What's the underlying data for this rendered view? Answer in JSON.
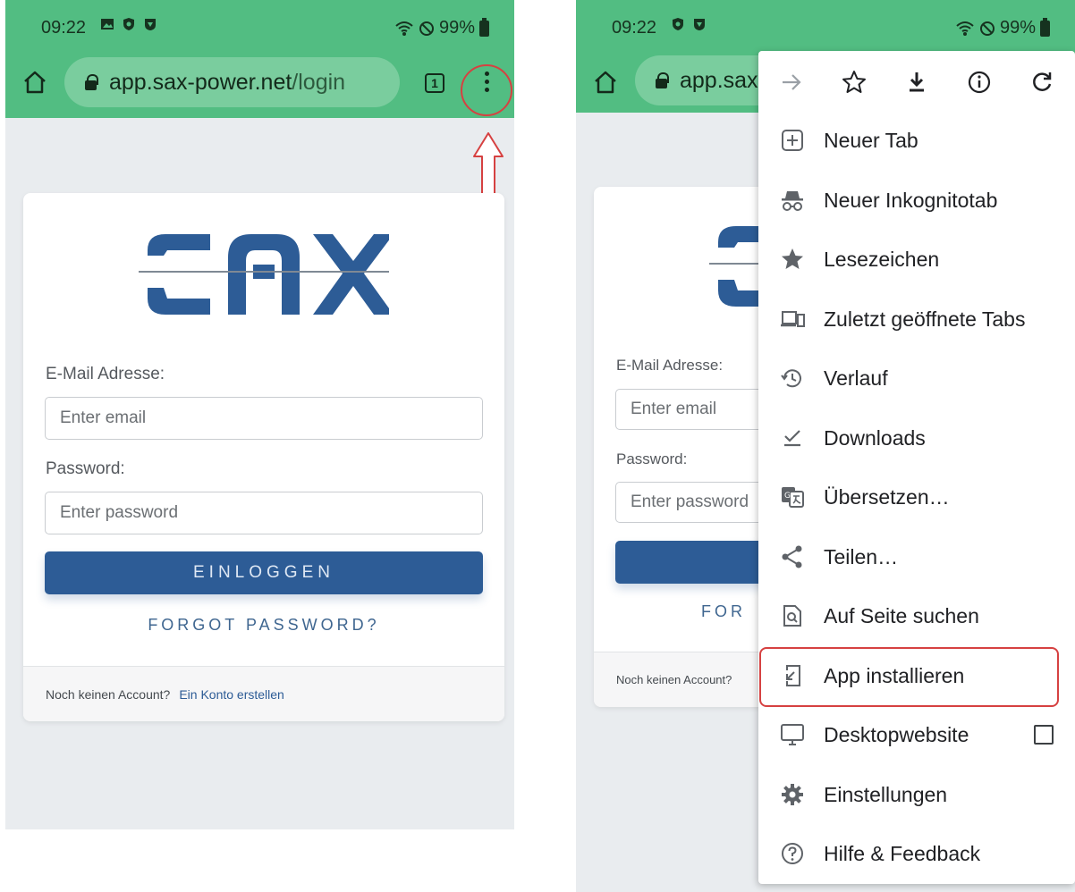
{
  "left_phone": {
    "status": {
      "time": "09:22",
      "battery": "99%"
    },
    "url": {
      "host": "app.sax-power.net",
      "path": "/login"
    },
    "tab_count": "1",
    "form": {
      "email_label": "E-Mail Adresse:",
      "email_placeholder": "Enter email",
      "password_label": "Password:",
      "password_placeholder": "Enter password",
      "login_button": "EINLOGGEN",
      "forgot_link": "FORGOT PASSWORD?",
      "footer_text": "Noch keinen Account?",
      "footer_link": "Ein Konto erstellen"
    }
  },
  "right_phone": {
    "status": {
      "time": "09:22",
      "battery": "99%"
    },
    "url": {
      "host": "app.sax"
    },
    "form": {
      "email_label": "E-Mail Adresse:",
      "email_placeholder": "Enter email",
      "password_label": "Password:",
      "password_placeholder": "Enter password",
      "forgot_partial": "FOR",
      "footer_text": "Noch keinen Account?"
    },
    "menu": {
      "items": [
        {
          "label": "Neuer Tab",
          "icon": "new-tab-icon"
        },
        {
          "label": "Neuer Inkognitotab",
          "icon": "incognito-icon"
        },
        {
          "label": "Lesezeichen",
          "icon": "star-filled-icon"
        },
        {
          "label": "Zuletzt geöffnete Tabs",
          "icon": "devices-icon"
        },
        {
          "label": "Verlauf",
          "icon": "history-icon"
        },
        {
          "label": "Downloads",
          "icon": "download-done-icon"
        },
        {
          "label": "Übersetzen…",
          "icon": "translate-icon"
        },
        {
          "label": "Teilen…",
          "icon": "share-icon"
        },
        {
          "label": "Auf Seite suchen",
          "icon": "find-in-page-icon"
        },
        {
          "label": "App installieren",
          "icon": "install-app-icon"
        },
        {
          "label": "Desktopwebsite",
          "icon": "desktop-icon"
        },
        {
          "label": "Einstellungen",
          "icon": "settings-icon"
        },
        {
          "label": "Hilfe & Feedback",
          "icon": "help-icon"
        }
      ]
    }
  },
  "colors": {
    "toolbar": "#52bd82",
    "brand_blue": "#2d5c96",
    "annotation_red": "#d64141"
  }
}
